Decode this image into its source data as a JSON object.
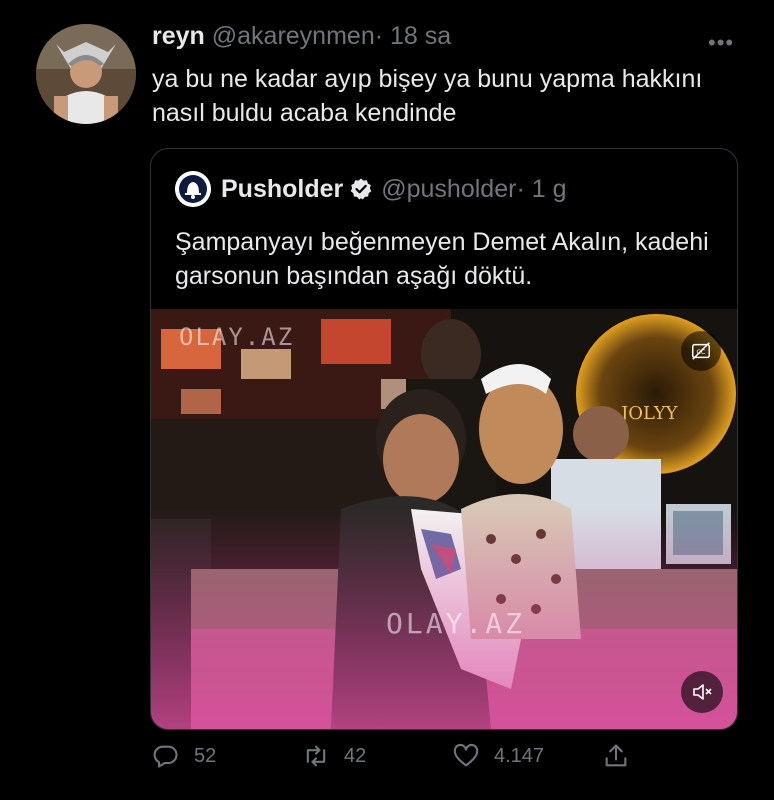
{
  "tweet": {
    "author_name": "reyn",
    "author_handle": "@akareynmen",
    "separator": "·",
    "time": "18 sa",
    "more_label": "•••",
    "text": "ya bu ne kadar ayıp bişey ya bunu yapma hakkını nasıl buldu acaba kendinde"
  },
  "quote": {
    "author_name": "Pusholder",
    "author_handle": "@pusholder",
    "separator": "·",
    "time": "1 g",
    "text": "Şampanyayı beğenmeyen Demet Akalın, kadehi garsonun başından aşağı döktü.",
    "video": {
      "watermark_top": "OLAY.AZ",
      "watermark_bottom": "OLAY.AZ",
      "sign_text": "JOLYY",
      "cc_icon": "closed-captions-off-icon",
      "mute_icon": "volume-muted-icon"
    }
  },
  "actions": {
    "replies": "52",
    "retweets": "42",
    "likes": "4.147",
    "reply_icon": "reply-icon",
    "retweet_icon": "retweet-icon",
    "like_icon": "heart-icon",
    "share_icon": "share-icon"
  },
  "colors": {
    "background": "#000000",
    "text": "#e7e9ea",
    "muted": "#71767b",
    "border": "#2f3336",
    "verified": "#e7e9ea"
  }
}
